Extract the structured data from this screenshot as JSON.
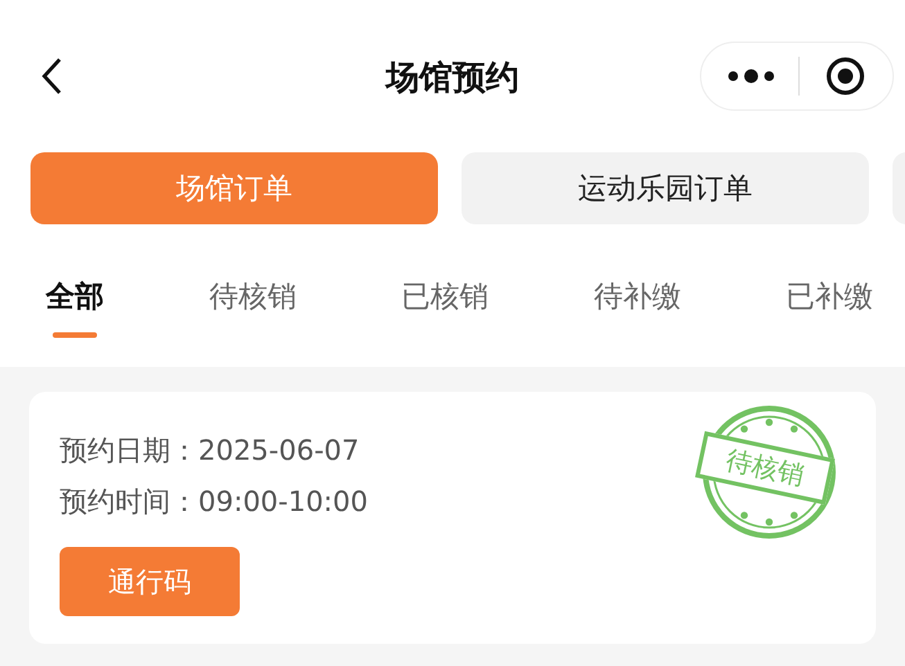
{
  "nav_bar": {
    "title": "场馆预约"
  },
  "segments": [
    {
      "label": "场馆订单",
      "selected": true
    },
    {
      "label": "运动乐园订单",
      "selected": false
    }
  ],
  "status_tabs": [
    {
      "label": "全部",
      "selected": true
    },
    {
      "label": "待核销",
      "selected": false
    },
    {
      "label": "已核销",
      "selected": false
    },
    {
      "label": "待补缴",
      "selected": false
    },
    {
      "label": "已补缴",
      "selected": false
    }
  ],
  "orders": [
    {
      "lines": [
        "预约日期：2025-06-07",
        "预约时间：09:00-10:00"
      ],
      "button": "通行码",
      "stamp": "待核销",
      "color": "#6cbf5a"
    }
  ]
}
